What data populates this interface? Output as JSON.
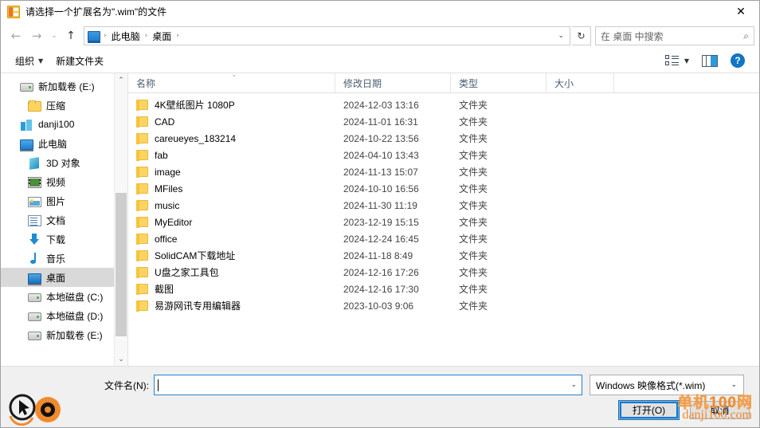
{
  "window": {
    "title": "请选择一个扩展名为\".wim\"的文件",
    "icon": "wim-file-icon",
    "close_label": "✕"
  },
  "nav": {
    "back_icon": "←",
    "forward_icon": "→",
    "recent_icon": "⌄",
    "up_icon": "↑",
    "breadcrumbs": [
      {
        "label": "此电脑"
      },
      {
        "label": "桌面"
      }
    ],
    "breadcrumb_sep": "›",
    "address_chevron": "⌄",
    "refresh_icon": "↻",
    "search_placeholder": "在 桌面 中搜索",
    "search_icon": "⌕"
  },
  "toolbar": {
    "organize_label": "组织",
    "organize_caret": "▼",
    "new_folder_label": "新建文件夹",
    "view_caret": "▼",
    "help_label": "?"
  },
  "sidebar": {
    "items": [
      {
        "label": "新加载卷 (E:)",
        "icon": "drive-icon",
        "indent": 1,
        "selected": false
      },
      {
        "label": "压缩",
        "icon": "folder-icon",
        "indent": 2,
        "selected": false
      },
      {
        "label": "danji100",
        "icon": "cloud-icon",
        "indent": 1,
        "selected": false
      },
      {
        "label": "此电脑",
        "icon": "pc-icon",
        "indent": 1,
        "selected": false
      },
      {
        "label": "3D 对象",
        "icon": "3d-objects-icon",
        "indent": 2,
        "selected": false
      },
      {
        "label": "视频",
        "icon": "video-icon",
        "indent": 2,
        "selected": false
      },
      {
        "label": "图片",
        "icon": "pictures-icon",
        "indent": 2,
        "selected": false
      },
      {
        "label": "文档",
        "icon": "documents-icon",
        "indent": 2,
        "selected": false
      },
      {
        "label": "下载",
        "icon": "downloads-icon",
        "indent": 2,
        "selected": false
      },
      {
        "label": "音乐",
        "icon": "music-icon",
        "indent": 2,
        "selected": false
      },
      {
        "label": "桌面",
        "icon": "desktop-icon",
        "indent": 2,
        "selected": true
      },
      {
        "label": "本地磁盘 (C:)",
        "icon": "drive-icon",
        "indent": 2,
        "selected": false
      },
      {
        "label": "本地磁盘 (D:)",
        "icon": "drive-icon",
        "indent": 2,
        "selected": false
      },
      {
        "label": "新加载卷 (E:)",
        "icon": "drive-icon",
        "indent": 2,
        "selected": false
      }
    ],
    "scroll_up_icon": "⌃",
    "scroll_down_icon": "⌄"
  },
  "filelist": {
    "columns": [
      {
        "key": "name",
        "label": "名称",
        "sorted": true,
        "sort_icon": "⌃"
      },
      {
        "key": "date",
        "label": "修改日期",
        "sorted": false
      },
      {
        "key": "type",
        "label": "类型",
        "sorted": false
      },
      {
        "key": "size",
        "label": "大小",
        "sorted": false
      }
    ],
    "rows": [
      {
        "name": "4K壁纸图片 1080P",
        "date": "2024-12-03 13:16",
        "type": "文件夹",
        "size": ""
      },
      {
        "name": "CAD",
        "date": "2024-11-01 16:31",
        "type": "文件夹",
        "size": ""
      },
      {
        "name": "careueyes_183214",
        "date": "2024-10-22 13:56",
        "type": "文件夹",
        "size": ""
      },
      {
        "name": "fab",
        "date": "2024-04-10 13:43",
        "type": "文件夹",
        "size": ""
      },
      {
        "name": "image",
        "date": "2024-11-13 15:07",
        "type": "文件夹",
        "size": ""
      },
      {
        "name": "MFiles",
        "date": "2024-10-10 16:56",
        "type": "文件夹",
        "size": ""
      },
      {
        "name": "music",
        "date": "2024-11-30 11:19",
        "type": "文件夹",
        "size": ""
      },
      {
        "name": "MyEditor",
        "date": "2023-12-19 15:15",
        "type": "文件夹",
        "size": ""
      },
      {
        "name": "office",
        "date": "2024-12-24 16:45",
        "type": "文件夹",
        "size": ""
      },
      {
        "name": "SolidCAM下载地址",
        "date": "2024-11-18 8:49",
        "type": "文件夹",
        "size": ""
      },
      {
        "name": "U盘之家工具包",
        "date": "2024-12-16 17:26",
        "type": "文件夹",
        "size": ""
      },
      {
        "name": "截图",
        "date": "2024-12-16 17:30",
        "type": "文件夹",
        "size": ""
      },
      {
        "name": "易游网讯专用编辑器",
        "date": "2023-10-03 9:06",
        "type": "文件夹",
        "size": ""
      }
    ]
  },
  "footer": {
    "filename_label": "文件名(N):",
    "filename_value": "",
    "filename_chevron": "⌄",
    "filter_value": "Windows 映像格式(*.wim)",
    "filter_chevron": "⌄",
    "open_button": "打开(O)",
    "cancel_button": "取消"
  },
  "watermark": {
    "line1": "单机100网",
    "line2": "danji100.com",
    "color": "#f08a2e"
  }
}
